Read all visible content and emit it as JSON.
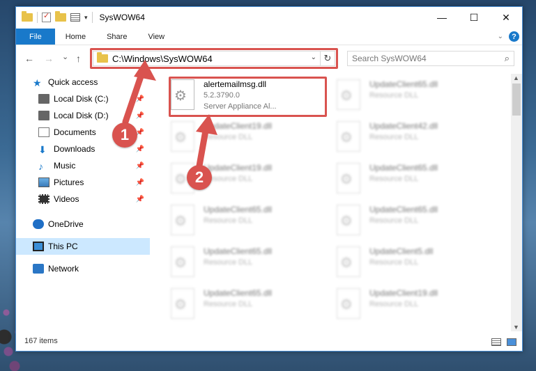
{
  "window": {
    "title": "SysWOW64",
    "controls": {
      "minimize": "—",
      "maximize": "☐",
      "close": "✕"
    }
  },
  "ribbon": {
    "tabs": [
      {
        "label": "File"
      },
      {
        "label": "Home"
      },
      {
        "label": "Share"
      },
      {
        "label": "View"
      }
    ],
    "help": "?"
  },
  "nav": {
    "back": "←",
    "forward": "→",
    "recent": "⌄",
    "up": "↑",
    "address": "C:\\Windows\\SysWOW64",
    "search_placeholder": "Search SysWOW64"
  },
  "sidebar": {
    "items": [
      {
        "label": "Quick access",
        "icon": "star-icon"
      },
      {
        "label": "Local Disk (C:)",
        "icon": "drive-icon"
      },
      {
        "label": "Local Disk (D:)",
        "icon": "drive-icon"
      },
      {
        "label": "Documents",
        "icon": "documents-icon"
      },
      {
        "label": "Downloads",
        "icon": "downloads-icon"
      },
      {
        "label": "Music",
        "icon": "music-icon"
      },
      {
        "label": "Pictures",
        "icon": "pictures-icon"
      },
      {
        "label": "Videos",
        "icon": "videos-icon"
      },
      {
        "label": "OneDrive",
        "icon": "onedrive-icon"
      },
      {
        "label": "This PC",
        "icon": "this-pc-icon"
      },
      {
        "label": "Network",
        "icon": "network-icon"
      }
    ]
  },
  "files": [
    {
      "name": "alertemailmsg.dll",
      "line1": "5.2.3790.0",
      "line2": "Server Appliance Al..."
    },
    {
      "name": "UpdateClient65.dll",
      "line1": "Resource DLL"
    },
    {
      "name": "UpdateClient19.dll",
      "line1": "Resource DLL"
    },
    {
      "name": "UpdateClient42.dll",
      "line1": "Resource DLL"
    },
    {
      "name": "UpdateClient19.dll",
      "line1": "Resource DLL"
    },
    {
      "name": "UpdateClient65.dll",
      "line1": "Resource DLL"
    },
    {
      "name": "UpdateClient65.dll",
      "line1": "Resource DLL"
    },
    {
      "name": "UpdateClient65.dll",
      "line1": "Resource DLL"
    },
    {
      "name": "UpdateClient65.dll",
      "line1": "Resource DLL"
    },
    {
      "name": "UpdateClient5.dll",
      "line1": "Resource DLL"
    },
    {
      "name": "UpdateClient65.dll",
      "line1": "Resource DLL"
    },
    {
      "name": "UpdateClient19.dll",
      "line1": "Resource DLL"
    }
  ],
  "status": {
    "item_count": "167 items"
  },
  "callouts": {
    "one": "1",
    "two": "2"
  },
  "colors": {
    "accent": "#1979ca",
    "highlight": "#d9534f",
    "selection": "#cce8ff"
  }
}
